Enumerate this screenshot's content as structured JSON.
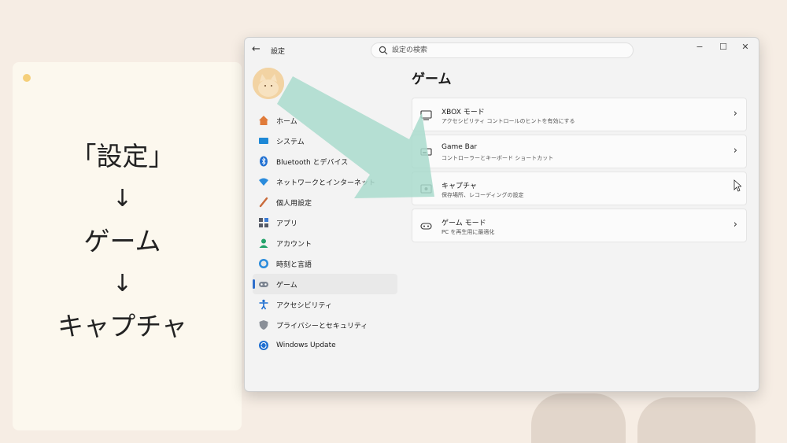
{
  "guide": {
    "step1": "「設定」",
    "arrow": "↓",
    "step2": "ゲーム",
    "step3": "キャプチャ"
  },
  "window": {
    "title": "設定",
    "search_placeholder": "設定の検索"
  },
  "sidebar": {
    "items": [
      {
        "label": "ホーム",
        "icon": "home-icon"
      },
      {
        "label": "システム",
        "icon": "system-icon"
      },
      {
        "label": "Bluetooth とデバイス",
        "icon": "bluetooth-icon"
      },
      {
        "label": "ネットワークとインターネット",
        "icon": "network-icon"
      },
      {
        "label": "個人用設定",
        "icon": "personalization-icon"
      },
      {
        "label": "アプリ",
        "icon": "apps-icon"
      },
      {
        "label": "アカウント",
        "icon": "accounts-icon"
      },
      {
        "label": "時刻と言語",
        "icon": "time-language-icon"
      },
      {
        "label": "ゲーム",
        "icon": "gaming-icon"
      },
      {
        "label": "アクセシビリティ",
        "icon": "accessibility-icon"
      },
      {
        "label": "プライバシーとセキュリティ",
        "icon": "privacy-shield-icon"
      },
      {
        "label": "Windows Update",
        "icon": "windows-update-icon"
      }
    ],
    "active_index": 8
  },
  "main": {
    "title": "ゲーム",
    "cards": [
      {
        "title": "XBOX モード",
        "desc": "アクセシビリティ コントロールのヒントを有効にする",
        "icon": "xbox-mode-icon"
      },
      {
        "title": "Game Bar",
        "desc": "コントローラーとキーボード ショートカット",
        "icon": "game-bar-icon"
      },
      {
        "title": "キャプチャ",
        "desc": "保存場所、レコーディングの設定",
        "icon": "capture-icon"
      },
      {
        "title": "ゲーム モード",
        "desc": "PC を再生用に最適化",
        "icon": "game-mode-icon"
      }
    ]
  },
  "colors": {
    "background": "#f6ede4",
    "accent": "#2f6ecb",
    "overlay_arrow": "#a9dbcc"
  }
}
